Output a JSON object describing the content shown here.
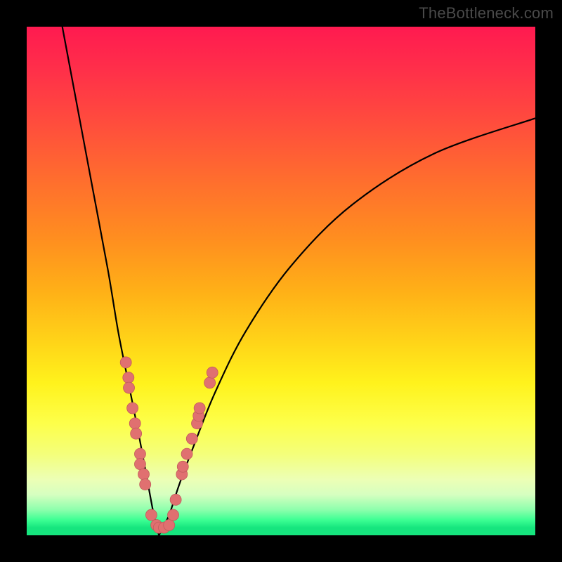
{
  "watermark": "TheBottleneck.com",
  "colors": {
    "frame": "#000000",
    "gradient_top": "#ff1a50",
    "gradient_bottom": "#16e57e",
    "curve": "#000000",
    "dots": "#e07070"
  },
  "chart_data": {
    "type": "line",
    "title": "",
    "xlabel": "",
    "ylabel": "",
    "xlim": [
      0,
      100
    ],
    "ylim": [
      0,
      100
    ],
    "axes_visible": false,
    "grid": false,
    "background_gradient": "bottleneck-rainbow",
    "notes": "V-shaped bottleneck curve; minimum near x≈26. Left branch rises steeply to top-left; right branch rises more gently toward upper-right. Pink dots cluster along both branches near the bottom.",
    "series": [
      {
        "name": "left-branch",
        "x": [
          7,
          10,
          13,
          16,
          18,
          20,
          22,
          23.5,
          25,
          26
        ],
        "y": [
          100,
          84,
          68,
          52,
          40,
          30,
          20,
          12,
          4,
          0
        ]
      },
      {
        "name": "right-branch",
        "x": [
          26,
          28,
          30,
          33,
          37,
          43,
          52,
          64,
          80,
          100
        ],
        "y": [
          0,
          4,
          10,
          18,
          28,
          40,
          53,
          65,
          75,
          82
        ]
      }
    ],
    "dots": [
      {
        "x": 19.5,
        "y": 34
      },
      {
        "x": 20.0,
        "y": 31
      },
      {
        "x": 20.1,
        "y": 29
      },
      {
        "x": 20.8,
        "y": 25
      },
      {
        "x": 21.3,
        "y": 22
      },
      {
        "x": 21.5,
        "y": 20
      },
      {
        "x": 22.3,
        "y": 16
      },
      {
        "x": 22.3,
        "y": 14
      },
      {
        "x": 23.0,
        "y": 12
      },
      {
        "x": 23.3,
        "y": 10
      },
      {
        "x": 24.5,
        "y": 4
      },
      {
        "x": 25.5,
        "y": 2
      },
      {
        "x": 26.0,
        "y": 1.5
      },
      {
        "x": 27.0,
        "y": 1.5
      },
      {
        "x": 28.0,
        "y": 2
      },
      {
        "x": 28.8,
        "y": 4
      },
      {
        "x": 29.3,
        "y": 7
      },
      {
        "x": 30.5,
        "y": 12
      },
      {
        "x": 30.7,
        "y": 13.5
      },
      {
        "x": 31.5,
        "y": 16
      },
      {
        "x": 32.5,
        "y": 19
      },
      {
        "x": 33.5,
        "y": 22
      },
      {
        "x": 33.8,
        "y": 23.5
      },
      {
        "x": 34.0,
        "y": 25
      },
      {
        "x": 36.0,
        "y": 30
      },
      {
        "x": 36.5,
        "y": 32
      }
    ]
  }
}
